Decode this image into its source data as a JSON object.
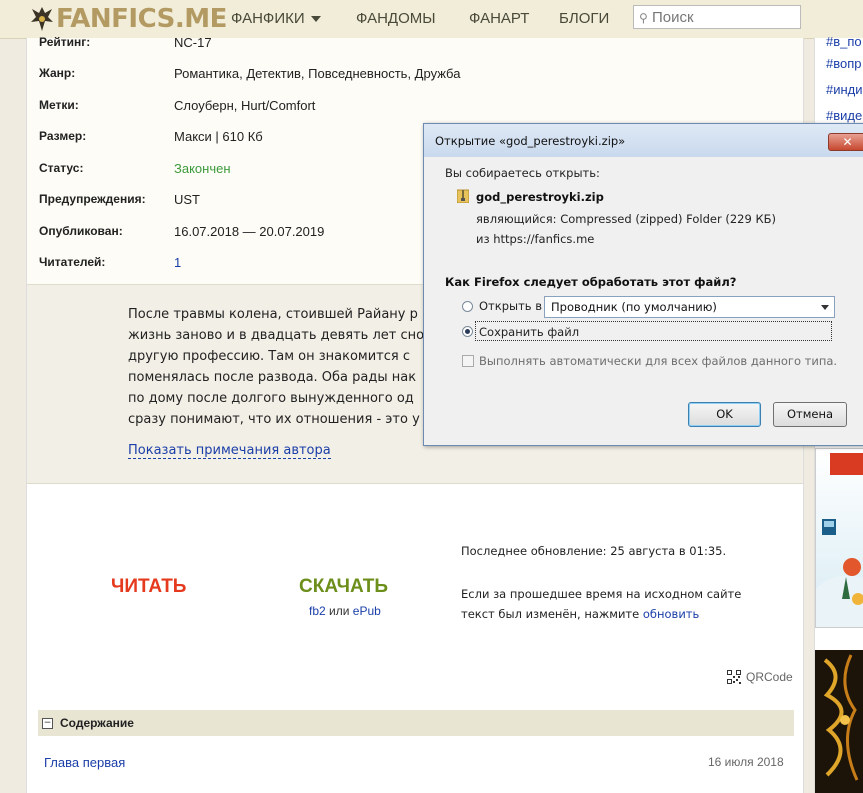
{
  "header": {
    "logo_text": "FANFICS.ME",
    "nav": [
      {
        "label": "ФАНФИКИ",
        "has_dropdown": true
      },
      {
        "label": "ФАНДОМЫ"
      },
      {
        "label": "ФАНАРТ"
      },
      {
        "label": "БЛОГИ"
      }
    ],
    "search_placeholder": "Поиск"
  },
  "info": {
    "rows": [
      {
        "label": "Рейтинг:",
        "value": "NC-17"
      },
      {
        "label": "Жанр:",
        "value": "Романтика, Детектив, Повседневность, Дружба"
      },
      {
        "label": "Метки:",
        "value": "Слоуберн, Hurt/Comfort"
      },
      {
        "label": "Размер:",
        "value": "Макси | 610 Кб"
      },
      {
        "label": "Статус:",
        "value": "Закончен"
      },
      {
        "label": "Предупреждения:",
        "value": "UST"
      },
      {
        "label": "Опубликован:",
        "value": "16.07.2018 — 20.07.2019"
      },
      {
        "label": "Читателей:",
        "value": "1"
      }
    ]
  },
  "summary": {
    "lines": [
      "После травмы колена, стоившей Райану р",
      "жизнь заново и в двадцать девять лет сно",
      "другую профессию. Там он знакомится с",
      "поменялась после развода. Оба рады нак",
      "по дому после долгого вынужденного од",
      "сразу понимают, что их отношения - это у"
    ],
    "author_notes_link": "Показать примечания автора"
  },
  "actions": {
    "read_label": "ЧИТАТЬ",
    "download_label": "СКАЧАТЬ",
    "format_fb2": "fb2",
    "format_or": "или",
    "format_epub": "ePub",
    "last_update": "Последнее обновление: 25 августа в 01:35.",
    "changed_text_1": "Если за прошедшее время на исходном сайте",
    "changed_text_2": "текст был изменён, нажмите",
    "update_link": "обновить",
    "qrcode_label": "QRCode"
  },
  "contents": {
    "toggle": "−",
    "title": "Содержание",
    "chapters": [
      {
        "title": "Глава первая",
        "date": "16 июля 2018"
      }
    ]
  },
  "sidebar": {
    "tags": [
      "#в_по",
      "#вопр",
      "#инди",
      "#виде"
    ]
  },
  "dialog": {
    "title": "Открытие «god_perestroyki.zip»",
    "close": "✕",
    "intro": "Вы собираетесь открыть:",
    "filename": "god_perestroyki.zip",
    "type_label": "являющийся:",
    "type_value": "Compressed (zipped) Folder (229 КБ)",
    "from_label": "из",
    "from_value": "https://fanfics.me",
    "question": "Как Firefox следует обработать этот файл?",
    "open_with_label": "Открыть в",
    "open_with_value": "Проводник (по умолчанию)",
    "save_label": "Сохранить файл",
    "auto_label": "Выполнять автоматически для всех файлов данного типа.",
    "ok_label": "OK",
    "cancel_label": "Отмена",
    "selected_option": "save"
  },
  "colors": {
    "read": "#e53a1e",
    "download": "#6c8e1a",
    "link": "#1a3ea8",
    "status_done": "#3c9a3c"
  }
}
